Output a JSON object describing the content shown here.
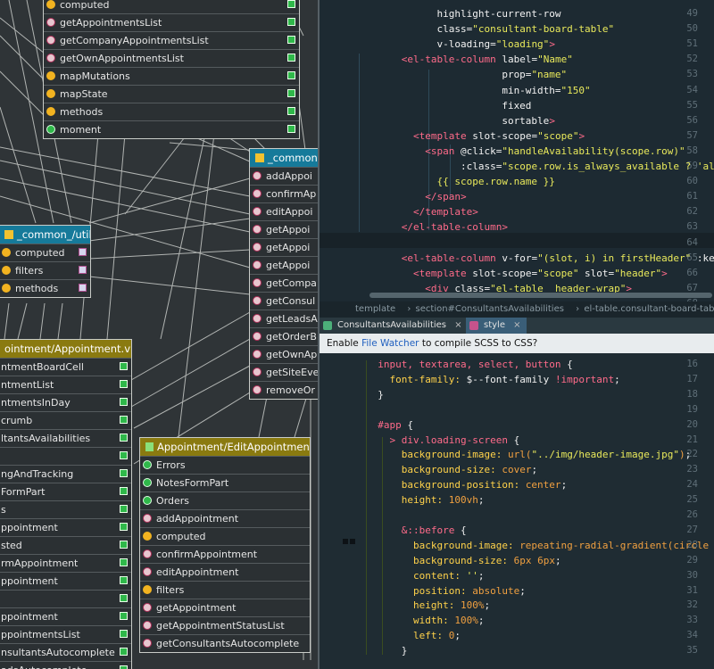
{
  "diagram": {
    "box_top": {
      "rows": [
        {
          "label": "computed",
          "icon": "comp"
        },
        {
          "label": "getAppointmentsList",
          "icon": "func"
        },
        {
          "label": "getCompanyAppointmentsList",
          "icon": "func"
        },
        {
          "label": "getOwnAppointmentsList",
          "icon": "func"
        },
        {
          "label": "mapMutations",
          "icon": "comp"
        },
        {
          "label": "mapState",
          "icon": "comp"
        },
        {
          "label": "methods",
          "icon": "comp"
        },
        {
          "label": "moment",
          "icon": "sq"
        }
      ]
    },
    "box_util": {
      "title": "_common_/util.js",
      "rows": [
        {
          "label": "computed"
        },
        {
          "label": "filters"
        },
        {
          "label": "methods"
        }
      ]
    },
    "box_common": {
      "title": "_common",
      "rows": [
        "addAppoi",
        "confirmAp",
        "editAppoi",
        "getAppoi",
        "getAppoi",
        "getAppoi",
        "getCompa",
        "getConsul",
        "getLeadsA",
        "getOrderB",
        "getOwnAp",
        "getSiteEve",
        "removeOr"
      ]
    },
    "box_appointment": {
      "title": "ointment/Appointment.vue",
      "rows": [
        "ntmentBoardCell",
        "ntmentList",
        "ntmentsInDay",
        "crumb",
        "ltantsAvailabilities",
        "",
        "ngAndTracking",
        "FormPart",
        "s",
        "ppointment",
        "sted",
        "rmAppointment",
        "ppointment",
        "",
        "ppointment",
        "ppointmentsList",
        "nsultantsAutocomplete",
        "adsAutocomplete"
      ]
    },
    "box_edit": {
      "title": "Appointment/EditAppointment.vue",
      "rows": [
        {
          "label": "Errors",
          "icon": "sq"
        },
        {
          "label": "NotesFormPart",
          "icon": "sq"
        },
        {
          "label": "Orders",
          "icon": "sq"
        },
        {
          "label": "addAppointment",
          "icon": "func"
        },
        {
          "label": "computed",
          "icon": "comp"
        },
        {
          "label": "confirmAppointment",
          "icon": "func"
        },
        {
          "label": "editAppointment",
          "icon": "func"
        },
        {
          "label": "filters",
          "icon": "comp"
        },
        {
          "label": "getAppointment",
          "icon": "func"
        },
        {
          "label": "getAppointmentStatusList",
          "icon": "func"
        },
        {
          "label": "getConsultantsAutocomplete",
          "icon": "func"
        }
      ]
    }
  },
  "editor": {
    "pane1_lines": [
      {
        "n": "49",
        "html": "<span class='t-attr'>            highlight-current-row</span>"
      },
      {
        "n": "50",
        "html": "<span class='t-attr'>            class=</span><span class='t-str'>\"consultant-board-table\"</span>"
      },
      {
        "n": "51",
        "html": "<span class='t-attr'>            v-loading=</span><span class='t-str'>\"loading\"</span><span class='t-tag'>&gt;</span>"
      },
      {
        "n": "52",
        "html": "<span class='t-tag'>      &lt;el-table-column </span><span class='t-attr'>label=</span><span class='t-str'>\"Name\"</span>"
      },
      {
        "n": "53",
        "html": "<span class='t-attr'>                       prop=</span><span class='t-str'>\"name\"</span>"
      },
      {
        "n": "54",
        "html": "<span class='t-attr'>                       min-width=</span><span class='t-str'>\"150\"</span>"
      },
      {
        "n": "55",
        "html": "<span class='t-attr'>                       fixed</span>"
      },
      {
        "n": "56",
        "html": "<span class='t-attr'>                       sortable</span><span class='t-tag'>&gt;</span>"
      },
      {
        "n": "57",
        "html": "<span class='t-tag'>        &lt;template </span><span class='t-attr'>slot-scope=</span><span class='t-str'>\"scope\"</span><span class='t-tag'>&gt;</span>"
      },
      {
        "n": "58",
        "html": "<span class='t-tag'>          &lt;span </span><span class='t-attr'>@click=</span><span class='t-str'>\"handleAvailability(scope.row)\"</span>"
      },
      {
        "n": "59",
        "html": "<span class='t-attr'>                :class=</span><span class='t-str'>\"scope.row.is_always_available ? 'al</span>"
      },
      {
        "n": "60",
        "html": "<span class='t-str'>            {{ scope.row.name }}</span>"
      },
      {
        "n": "61",
        "html": "<span class='t-tag'>          &lt;/span&gt;</span>"
      },
      {
        "n": "62",
        "html": "<span class='t-tag'>        &lt;/template&gt;</span>"
      },
      {
        "n": "63",
        "html": "<span class='t-tag'>      &lt;/el-table-column&gt;</span>"
      },
      {
        "n": "64",
        "html": ""
      },
      {
        "n": "65",
        "html": "<span class='t-tag'>      &lt;el-table-column </span><span class='t-attr'>v-for=</span><span class='t-str'>\"(slot, i) in firstHeader\"</span><span class='t-attr'> :key=</span><span class='t-str'>\"s</span>"
      },
      {
        "n": "66",
        "html": "<span class='t-tag'>        &lt;template </span><span class='t-attr'>slot-scope=</span><span class='t-str'>\"scope\"</span><span class='t-attr'> slot=</span><span class='t-str'>\"header\"</span><span class='t-tag'>&gt;</span>"
      },
      {
        "n": "67",
        "html": "<span class='t-tag'>          &lt;div </span><span class='t-attr'>class=</span><span class='t-str'>\"el-table__header-wrap\"</span><span class='t-tag'>&gt;</span>"
      },
      {
        "n": "68",
        "html": ""
      }
    ],
    "breadcrumb": [
      "template",
      "section#ConsultantsAvailabilities",
      "el-table.consultant-board-table"
    ],
    "tabs": [
      {
        "label": "ConsultantsAvailabilities",
        "close": "×"
      },
      {
        "label": "style",
        "close": "×"
      }
    ],
    "notice": {
      "prefix": "Enable ",
      "link": "File Watcher",
      "suffix": " to compile SCSS to CSS?"
    },
    "pane2_lines": [
      {
        "n": "16",
        "html": "<span class='t-kw'>  input, textarea, select, button </span><span class='t-plain'>{</span>"
      },
      {
        "n": "17",
        "html": "<span class='t-prop'>    font-family: </span><span class='t-plain'>$--font-family </span><span class='t-kw'>!important</span><span class='t-plain'>;</span>"
      },
      {
        "n": "18",
        "html": "<span class='t-plain'>  }</span>"
      },
      {
        "n": "19",
        "html": ""
      },
      {
        "n": "20",
        "html": "<span class='t-kw'>  #app </span><span class='t-plain'>{</span>"
      },
      {
        "n": "21",
        "html": "<span class='t-kw'>    &gt; div.loading-screen </span><span class='t-plain'>{</span>"
      },
      {
        "n": "22",
        "html": "<span class='t-prop'>      background-image: </span><span class='t-val'>url(</span><span class='t-str'>\"../img/header-image.jpg\"</span><span class='t-val'>)</span><span class='t-plain'>;</span>"
      },
      {
        "n": "23",
        "html": "<span class='t-prop'>      background-size: </span><span class='t-val'>cover</span><span class='t-plain'>;</span>"
      },
      {
        "n": "24",
        "html": "<span class='t-prop'>      background-position: </span><span class='t-val'>center</span><span class='t-plain'>;</span>"
      },
      {
        "n": "25",
        "html": "<span class='t-prop'>      height: </span><span class='t-val'>100vh</span><span class='t-plain'>;</span>"
      },
      {
        "n": "26",
        "html": ""
      },
      {
        "n": "27",
        "html": "<span class='t-kw'>      &amp;::before </span><span class='t-plain'>{</span>"
      },
      {
        "n": "28",
        "html": "<span class='t-prop'>        background-image: </span><span class='t-val'>repeating-radial-gradient(circle at center, r</span>"
      },
      {
        "n": "29",
        "html": "<span class='t-prop'>        background-size: </span><span class='t-val'>6px 6px</span><span class='t-plain'>;</span>"
      },
      {
        "n": "30",
        "html": "<span class='t-prop'>        content: </span><span class='t-str'>''</span><span class='t-plain'>;</span>"
      },
      {
        "n": "31",
        "html": "<span class='t-prop'>        position: </span><span class='t-val'>absolute</span><span class='t-plain'>;</span>"
      },
      {
        "n": "32",
        "html": "<span class='t-prop'>        height: </span><span class='t-val'>100%</span><span class='t-plain'>;</span>"
      },
      {
        "n": "33",
        "html": "<span class='t-prop'>        width: </span><span class='t-val'>100%</span><span class='t-plain'>;</span>"
      },
      {
        "n": "34",
        "html": "<span class='t-prop'>        left: </span><span class='t-val'>0</span><span class='t-plain'>;</span>"
      },
      {
        "n": "35",
        "html": "<span class='t-plain'>      }</span>"
      }
    ]
  }
}
